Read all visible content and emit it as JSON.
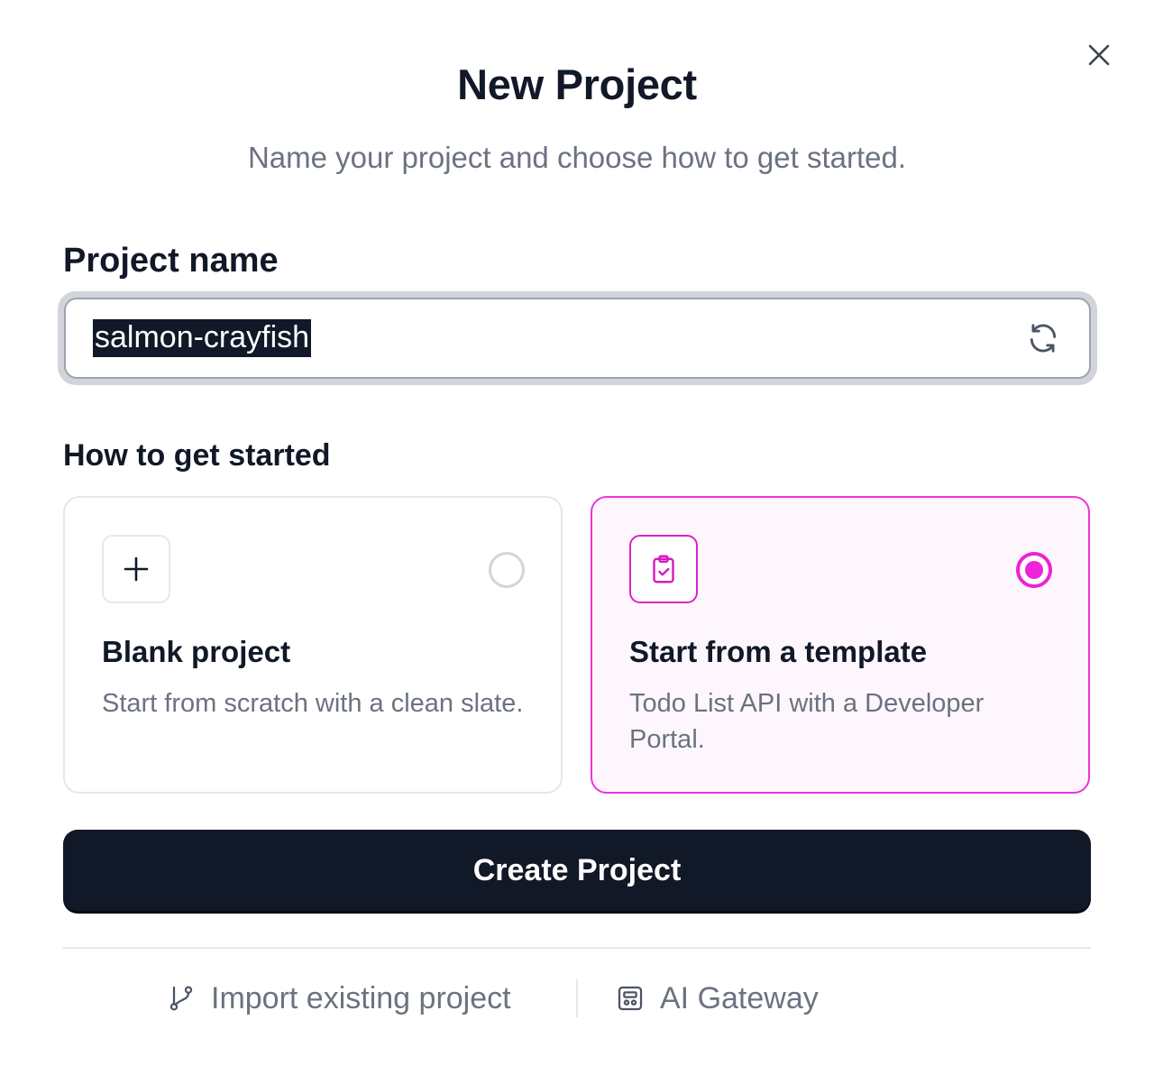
{
  "dialog": {
    "title": "New Project",
    "subtitle": "Name your project and choose how to get started."
  },
  "project_name": {
    "label": "Project name",
    "value": "salmon-crayfish"
  },
  "get_started": {
    "label": "How to get started",
    "options": [
      {
        "title": "Blank project",
        "description": "Start from scratch with a clean slate.",
        "icon": "plus-icon",
        "selected": false
      },
      {
        "title": "Start from a template",
        "description": "Todo List API with a Developer Portal.",
        "icon": "clipboard-check-icon",
        "selected": true
      }
    ]
  },
  "actions": {
    "create_label": "Create Project"
  },
  "footer": {
    "import_label": "Import existing project",
    "gateway_label": "AI Gateway"
  },
  "colors": {
    "accent": "#ee22d6",
    "primary_button": "#111827",
    "muted_text": "#6b7280"
  }
}
